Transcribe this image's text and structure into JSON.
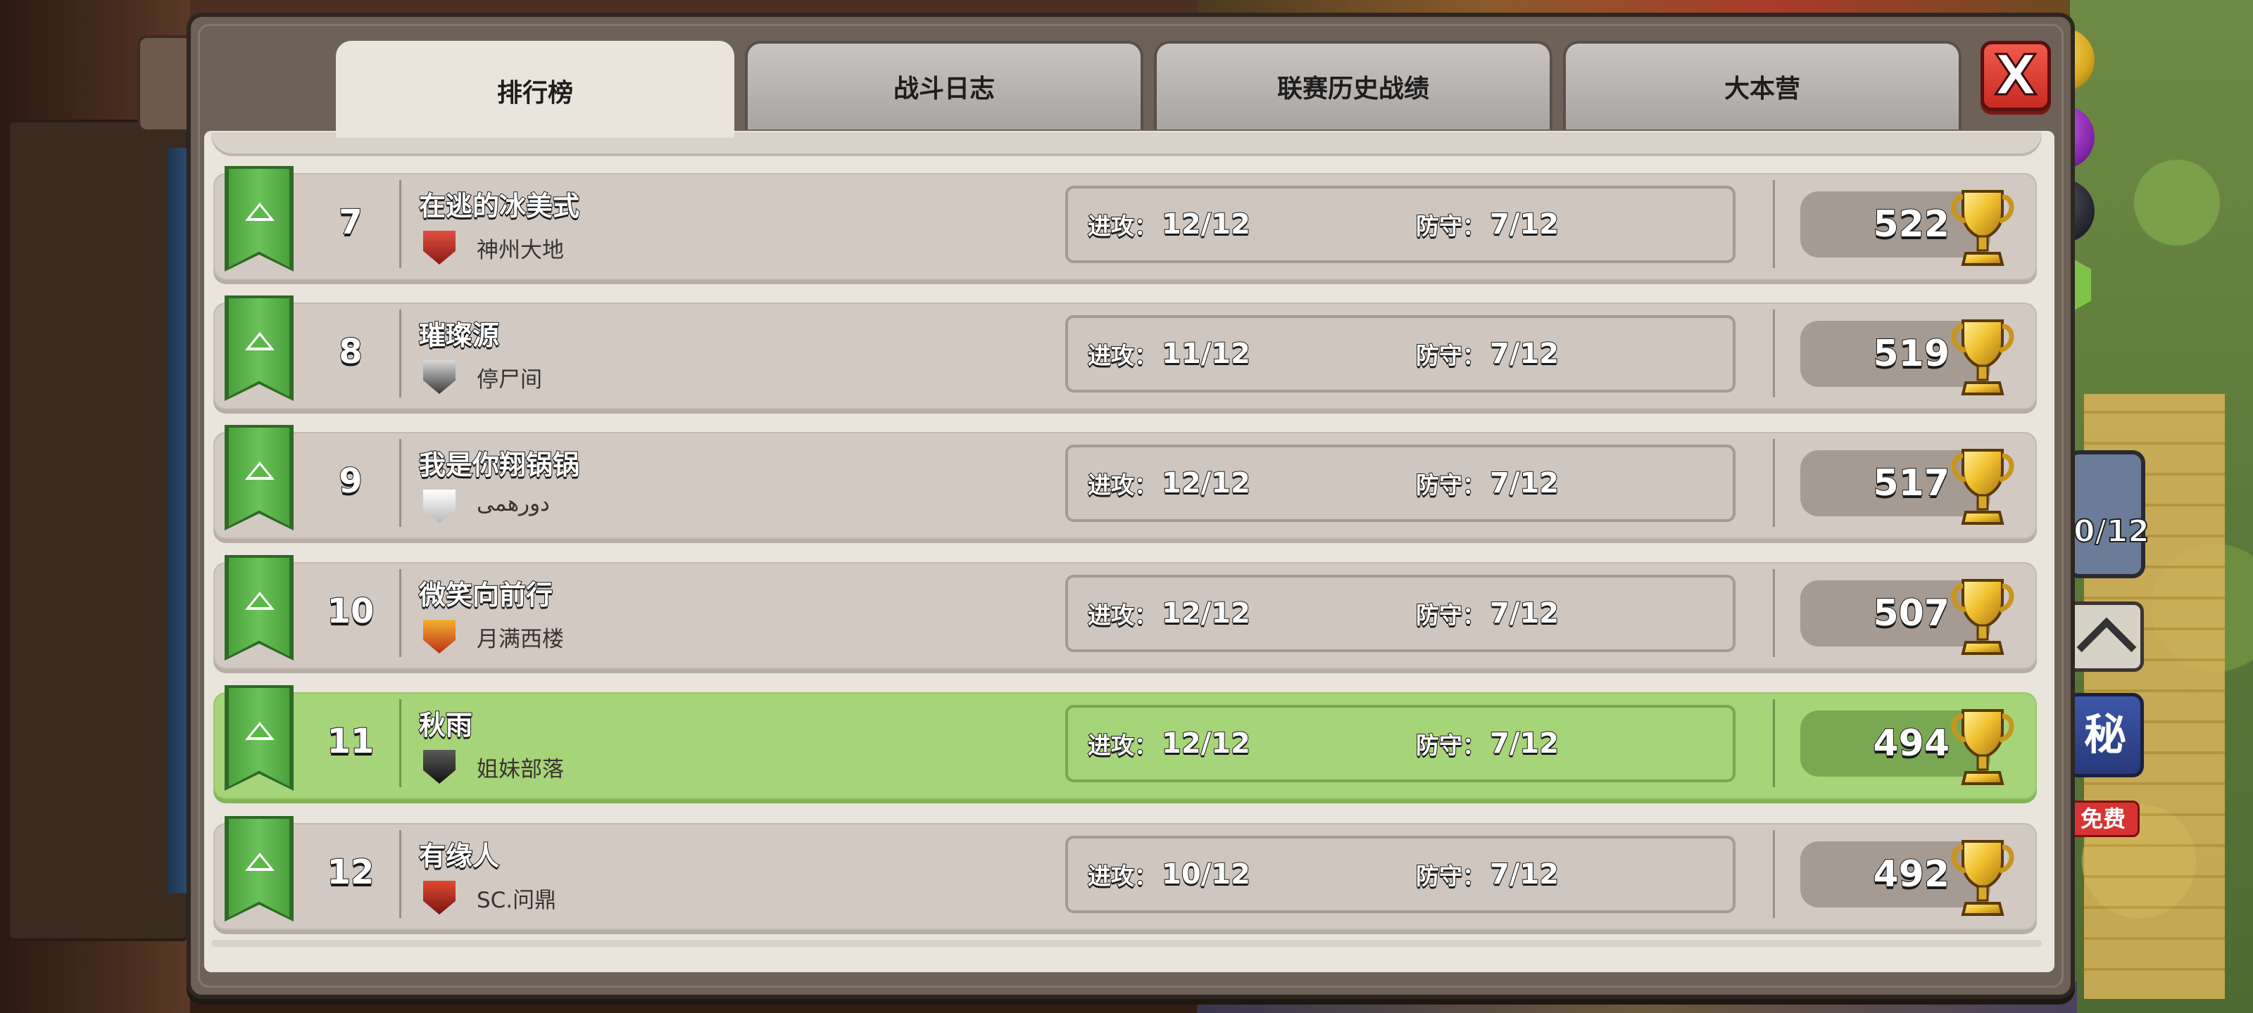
{
  "tabs": [
    {
      "label": "排行榜",
      "active": true
    },
    {
      "label": "战斗日志",
      "active": false
    },
    {
      "label": "联赛历史战绩",
      "active": false
    },
    {
      "label": "大本营",
      "active": false
    }
  ],
  "close_label": "X",
  "attack_label": "进攻：",
  "defense_label": "防守：",
  "colors": {
    "row_default": "#d2c9c3",
    "row_highlight": "#a6d478",
    "ribbon_green": "#5ab848",
    "close_red": "#e04a3c"
  },
  "rows": [
    {
      "rank": "7",
      "name": "在逃的冰美式",
      "clan": "神州大地",
      "attack": "12/12",
      "defense": "7/12",
      "score": "522",
      "badge": "red-shield-badge",
      "highlight": false
    },
    {
      "rank": "8",
      "name": "璀璨源",
      "clan": "停尸间",
      "attack": "11/12",
      "defense": "7/12",
      "score": "519",
      "badge": "winged-skull-badge",
      "highlight": false
    },
    {
      "rank": "9",
      "name": "我是你翔锅锅",
      "clan": "دورهمی",
      "attack": "12/12",
      "defense": "7/12",
      "score": "517",
      "badge": "white-shield-badge",
      "highlight": false
    },
    {
      "rank": "10",
      "name": "微笑向前行",
      "clan": "月满西楼",
      "attack": "12/12",
      "defense": "7/12",
      "score": "507",
      "badge": "phoenix-badge",
      "highlight": false
    },
    {
      "rank": "11",
      "name": "秋雨",
      "clan": "姐妹部落",
      "attack": "12/12",
      "defense": "7/12",
      "score": "494",
      "badge": "black-chevron-badge",
      "highlight": true
    },
    {
      "rank": "12",
      "name": "有缘人",
      "clan": "SC.问鼎",
      "attack": "10/12",
      "defense": "7/12",
      "score": "492",
      "badge": "flame-shield-badge",
      "highlight": false
    }
  ],
  "side": {
    "secret_label": "秘",
    "free_label": "免费",
    "card_text": "0/12"
  }
}
